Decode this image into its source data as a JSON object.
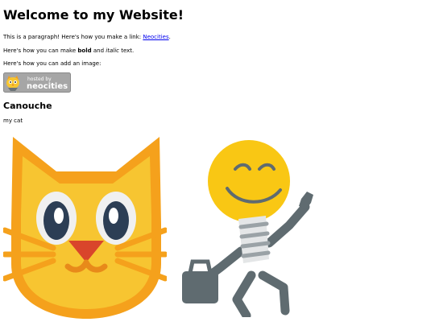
{
  "page": {
    "heading": "Welcome to my Website!",
    "para1_prefix": "This is a paragraph! Here's how you make a link: ",
    "link_text": "Neocities",
    "para1_suffix": ".",
    "para2_prefix": "Here's how you can make ",
    "bold_text": "bold",
    "para2_mid": " and ",
    "italic_text": "italic",
    "para2_suffix": " text.",
    "para3": "Here's how you can add an image:",
    "badge_small": "hosted by",
    "badge_big": "neocities",
    "subheading": "Canouche",
    "caption": "my cat"
  },
  "colors": {
    "link": "#0000ee",
    "cat_orange": "#f5a11c",
    "cat_yellow": "#f7c531",
    "bulb_yellow": "#f9c714",
    "figure_gray": "#5f6b70"
  }
}
